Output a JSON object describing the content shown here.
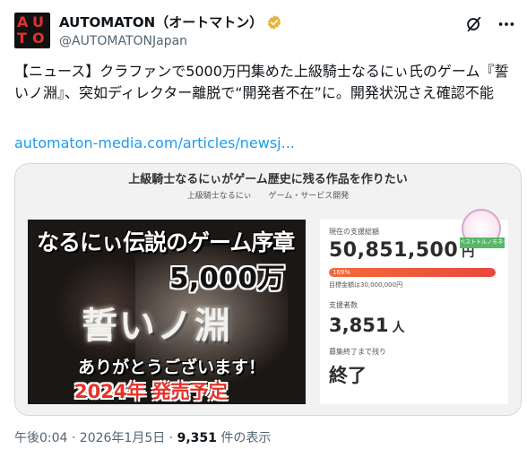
{
  "account": {
    "display_name": "AUTOMATON（オートマトン）",
    "handle": "@AUTOMATONJapan",
    "avatar_text": [
      "A",
      "U",
      "T",
      "O"
    ]
  },
  "icons": {
    "verified": "verified-badge-icon",
    "grok": "grok-icon",
    "more": "more-icon"
  },
  "tweet": {
    "text": "【ニュース】クラファンで5000万円集めた上級騎士なるにぃ氏のゲーム『誓いノ淵』、突如ディレクター離脱で“開発者不在”に。開発状況さえ確認不能",
    "link": "automaton-media.com/articles/newsj..."
  },
  "card": {
    "project_title": "上級騎士なるにぃがゲーム歴史に残る作品を作りたい",
    "meta": [
      "上級騎士なるにぃ",
      "ゲーム・サービス開発"
    ],
    "hero": {
      "line1": "なるにぃ伝説のゲーム序章",
      "line2": "5,000万",
      "line3": "誓いノ淵",
      "line4": "ありがとうございます！",
      "line5": "2024年 発売予定"
    },
    "panel": {
      "badge_text": "ベストトルノモネート",
      "current_label": "現在の支援総額",
      "amount": "50,851,500",
      "amount_unit": "円",
      "progress_label": "169%",
      "progress_value": 1.0,
      "goal": "目標金額は30,000,000円",
      "backers_label": "支援者数",
      "backers": "3,851",
      "backers_unit": "人",
      "end_label": "募集終了まで残り",
      "end_value": "終了"
    }
  },
  "footer": {
    "time": "午後0:04 · 2026年1月5日 · ",
    "views": "9,351",
    "views_suffix": " 件の表示"
  },
  "colors": {
    "link": "#1d9bf0",
    "verified": "#e8b339",
    "progress": "#e8483c"
  }
}
